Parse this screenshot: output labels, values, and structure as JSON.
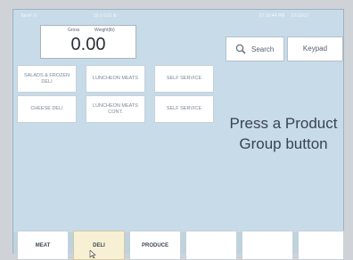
{
  "status": {
    "left": "Tare#: 0",
    "mid": "50 x 0.01 lb",
    "time": "07:50:44 PM",
    "date": "07/16/17"
  },
  "weight": {
    "gross_label": "Gross",
    "weight_label": "Weight(lb)",
    "value": "0.00"
  },
  "toolbar": {
    "search_label": "Search",
    "search_icon": "search-icon",
    "keypad_label": "Keypad"
  },
  "product_groups": [
    "SALADS & FROZEN DELI",
    "LUNCHEON MEATS",
    "SELF SERVICE",
    "CHEESE DELI",
    "LUNCHEON MEATS CONT.",
    "SELF SERVICE"
  ],
  "prompt": "Press a Product Group button",
  "tabs": [
    "MEAT",
    "DELI",
    "PRODUCE",
    "",
    "",
    ""
  ],
  "active_tab": "DELI"
}
